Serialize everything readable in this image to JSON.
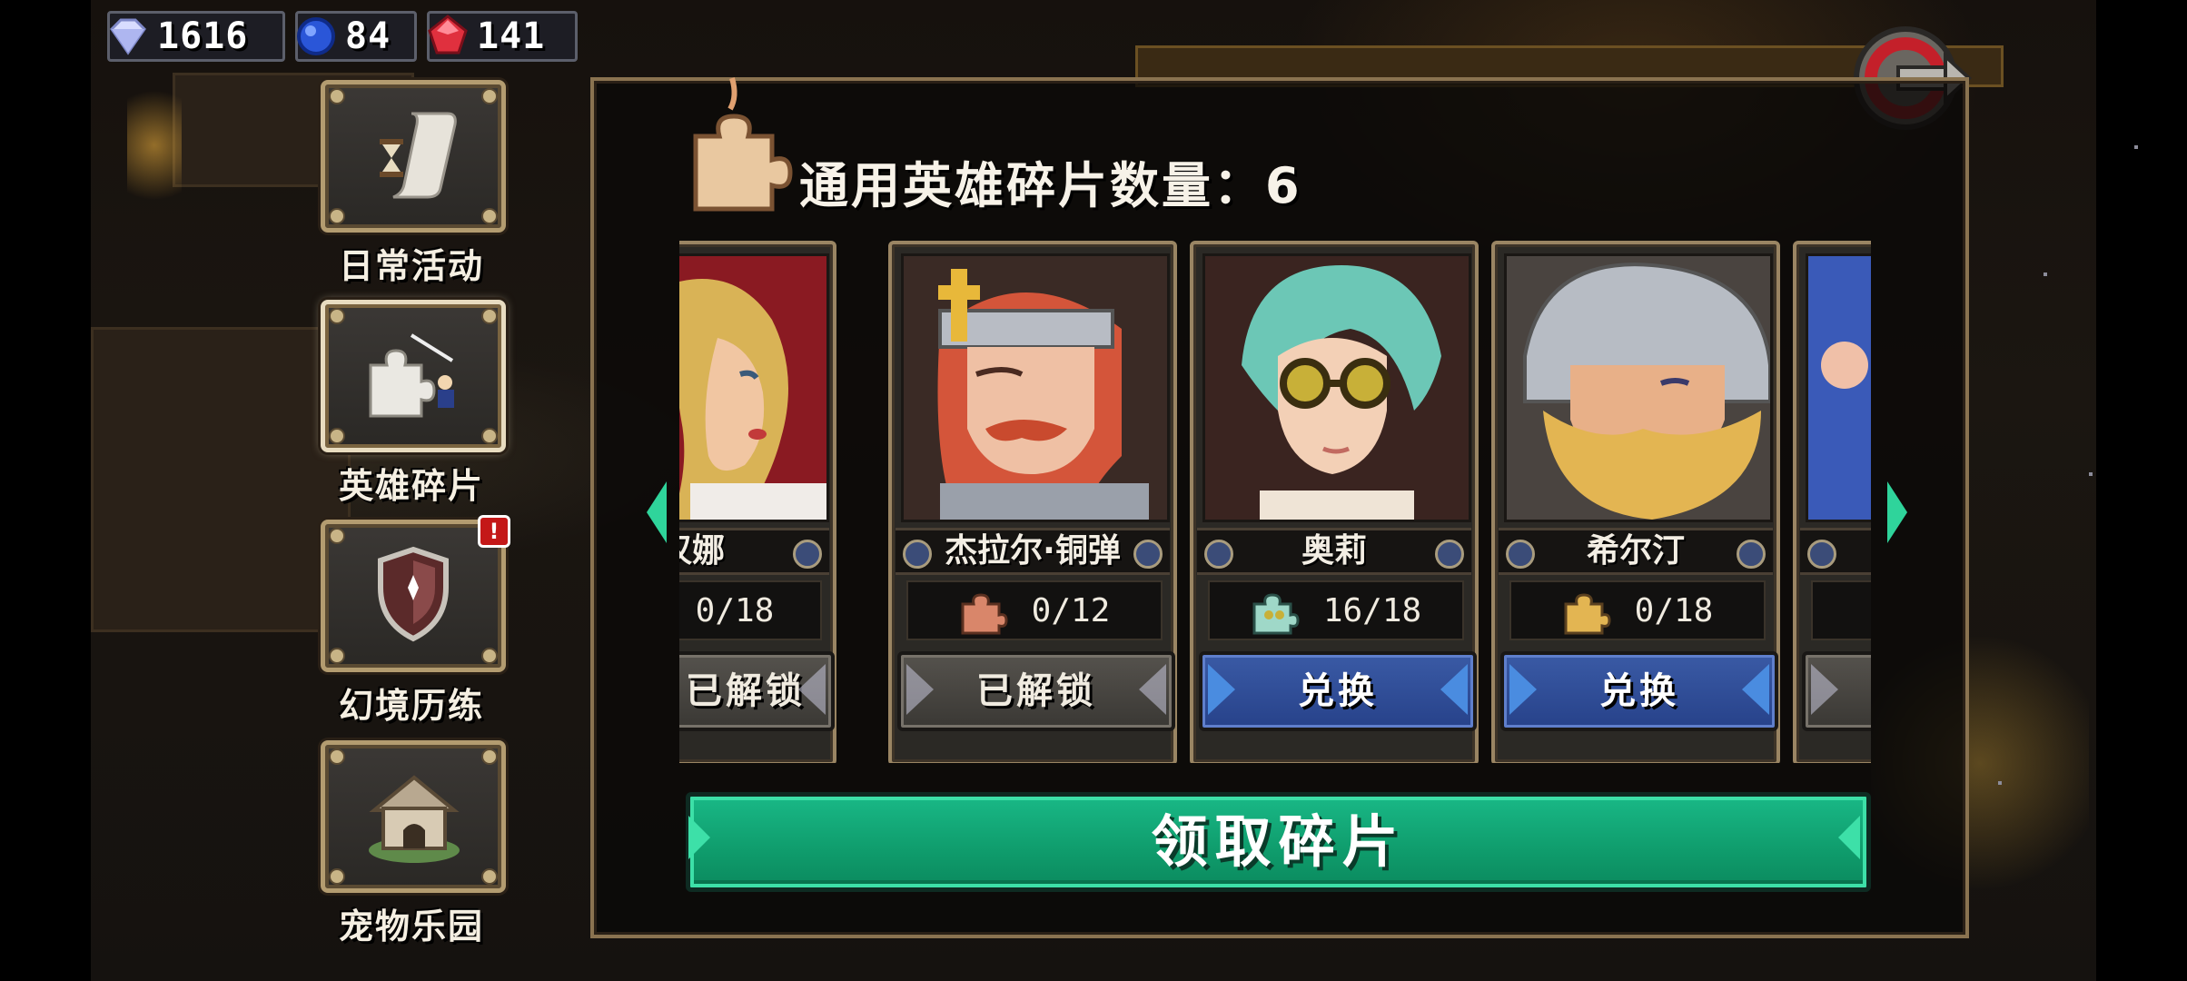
{
  "currencies": [
    {
      "icon": "diamond-icon",
      "value": "1616"
    },
    {
      "icon": "blue-gem-icon",
      "value": "84"
    },
    {
      "icon": "red-gem-icon",
      "value": "141"
    }
  ],
  "side_menu": [
    {
      "label": "日常活动",
      "icon": "scroll-hourglass-icon",
      "active": false,
      "alert": false
    },
    {
      "label": "英雄碎片",
      "icon": "puzzle-piece-icon",
      "active": true,
      "alert": false
    },
    {
      "label": "幻境历练",
      "icon": "shield-icon",
      "active": false,
      "alert": true
    },
    {
      "label": "宠物乐园",
      "icon": "doghouse-icon",
      "active": false,
      "alert": false
    }
  ],
  "alert_badge": "!",
  "panel": {
    "title": "通用英雄碎片数量：6",
    "claim_label": "领取碎片"
  },
  "heroes": [
    {
      "name": "汉娜",
      "count": "0/18",
      "action": "已解锁",
      "state": "locked",
      "icon": "hanna-fragment-icon"
    },
    {
      "name": "杰拉尔·铜弹",
      "count": "0/12",
      "action": "已解锁",
      "state": "locked",
      "icon": "gerard-fragment-icon"
    },
    {
      "name": "奥莉",
      "count": "16/18",
      "action": "兑换",
      "state": "redeem",
      "icon": "olly-fragment-icon"
    },
    {
      "name": "希尔汀",
      "count": "0/18",
      "action": "兑换",
      "state": "redeem",
      "icon": "hilding-fragment-icon"
    }
  ],
  "colors": {
    "claim_green": "#0f9c6c",
    "redeem_blue": "#2f4d96",
    "locked_gray": "#4a4743",
    "card_border": "#9a8563"
  }
}
